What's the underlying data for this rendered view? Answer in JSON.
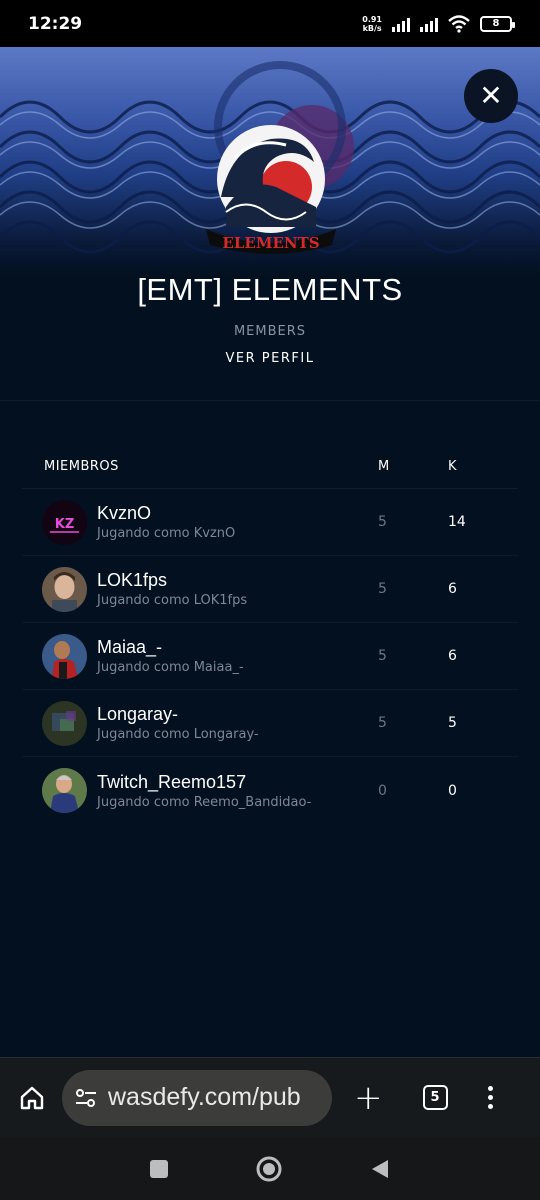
{
  "status_bar": {
    "time": "12:29",
    "net_speed": "0.91",
    "net_unit": "kB/s",
    "battery": "8"
  },
  "clan": {
    "title": "[EMT] ELEMENTS",
    "logo_text": "ELEMENTS",
    "members_label": "MEMBERS",
    "profile_link": "VER PERFIL"
  },
  "table": {
    "headers": {
      "name": "MIEMBROS",
      "m": "M",
      "k": "K"
    },
    "rows": [
      {
        "name": "KvznO",
        "playing": "Jugando como KvznO",
        "m": "5",
        "k": "14"
      },
      {
        "name": "LOK1fps",
        "playing": "Jugando como LOK1fps",
        "m": "5",
        "k": "6"
      },
      {
        "name": "Maiaa_-",
        "playing": "Jugando como Maiaa_-",
        "m": "5",
        "k": "6"
      },
      {
        "name": "Longaray-",
        "playing": "Jugando como Longaray-",
        "m": "5",
        "k": "5"
      },
      {
        "name": "Twitch_Reemo157",
        "playing": "Jugando como Reemo_Bandidao-",
        "m": "0",
        "k": "0"
      }
    ]
  },
  "browser": {
    "url": "wasdefy.com/pub",
    "tab_count": "5"
  },
  "colors": {
    "background": "#03101f",
    "accent_red": "#d42a2a"
  }
}
